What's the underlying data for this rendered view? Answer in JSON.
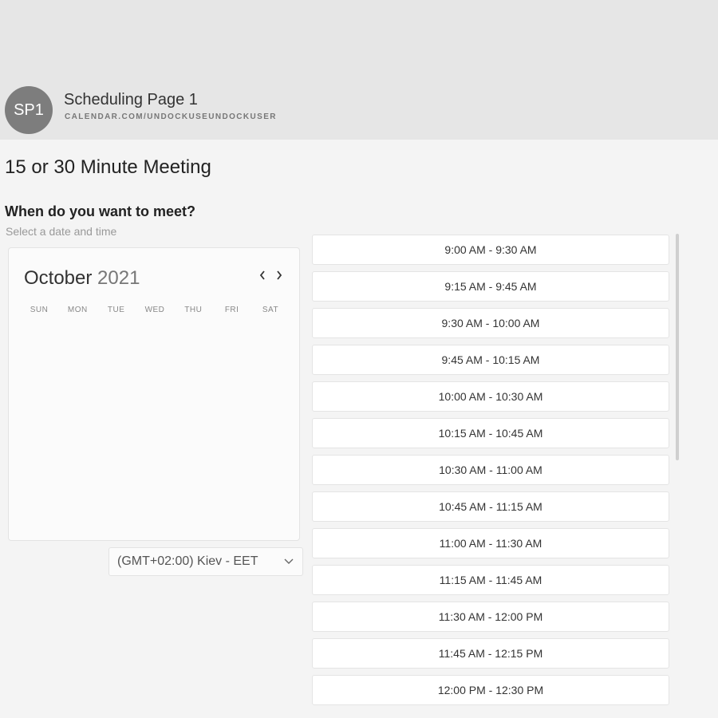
{
  "header": {
    "avatar_initials": "SP1",
    "page_name": "Scheduling Page 1",
    "page_url": "CALENDAR.COM/UNDOCKUSEUNDOCKUSER"
  },
  "meeting": {
    "title": "15 or 30 Minute Meeting",
    "question": "When do you want to meet?",
    "subtitle": "Select a date and time"
  },
  "calendar": {
    "month": "October",
    "year": "2021",
    "weekdays": [
      "SUN",
      "MON",
      "TUE",
      "WED",
      "THU",
      "FRI",
      "SAT"
    ],
    "prev_icon": "chevron-left-icon",
    "next_icon": "chevron-right-icon"
  },
  "timezone": {
    "selected": "(GMT+02:00) Kiev - EET",
    "icon": "chevron-down-icon"
  },
  "slots": [
    "9:00 AM - 9:30 AM",
    "9:15 AM - 9:45 AM",
    "9:30 AM - 10:00 AM",
    "9:45 AM - 10:15 AM",
    "10:00 AM - 10:30 AM",
    "10:15 AM - 10:45 AM",
    "10:30 AM - 11:00 AM",
    "10:45 AM - 11:15 AM",
    "11:00 AM - 11:30 AM",
    "11:15 AM - 11:45 AM",
    "11:30 AM - 12:00 PM",
    "11:45 AM - 12:15 PM",
    "12:00 PM - 12:30 PM"
  ],
  "colors": {
    "header_band": "#e6e6e6",
    "avatar": "#7d7d7d",
    "page_background": "#f4f4f4"
  }
}
